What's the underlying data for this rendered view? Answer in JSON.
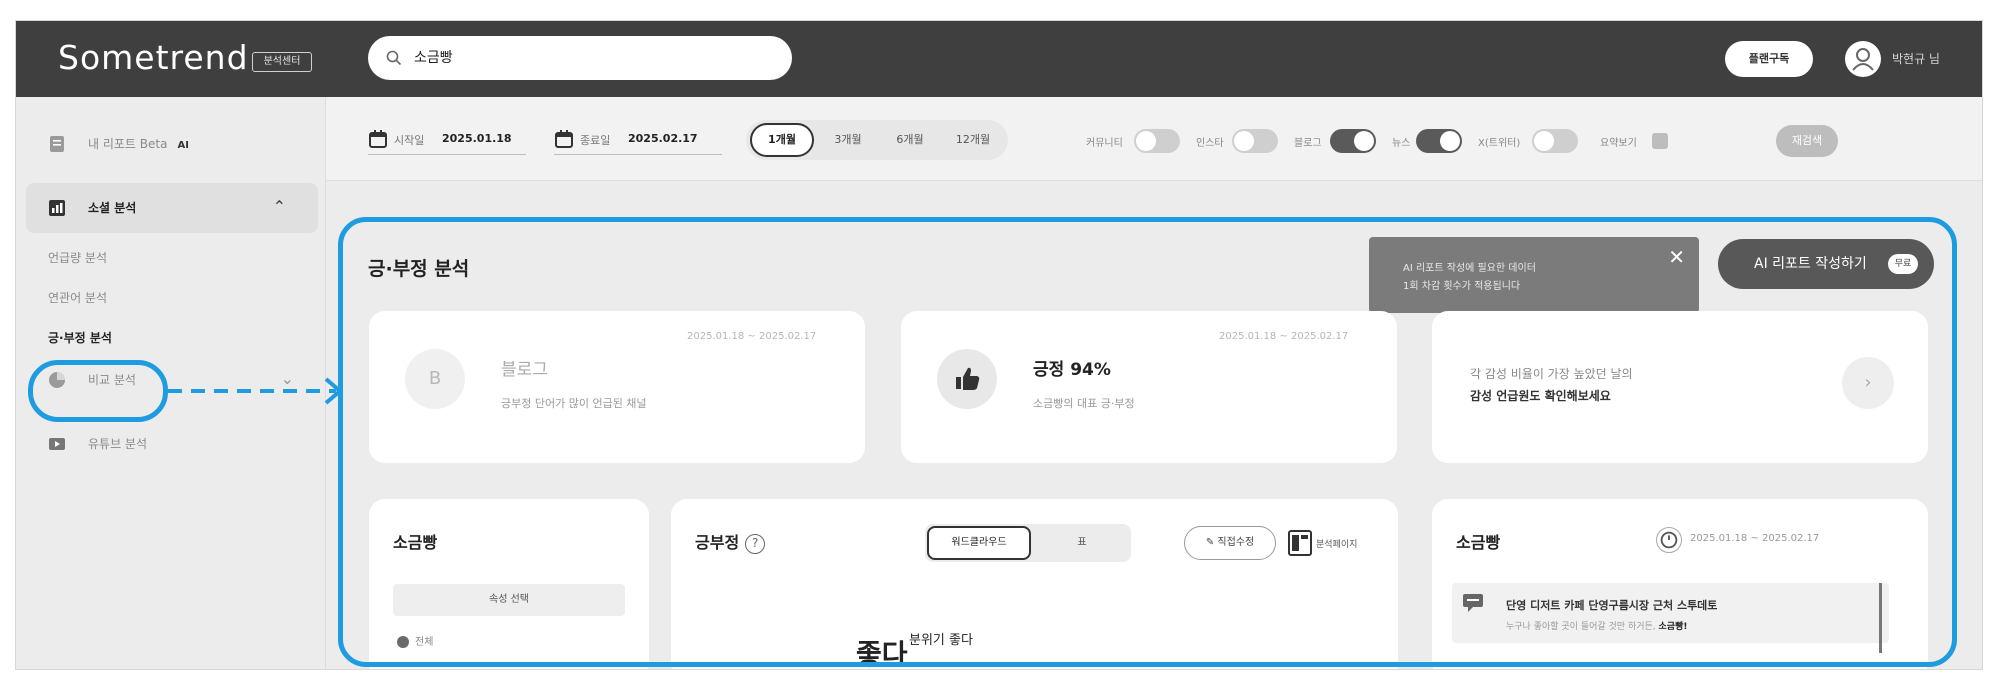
{
  "app": {
    "brand": "Sometrend",
    "brand_badge": "분석센터",
    "upgrade_label": "플랜구독",
    "user_name": "박현규 님"
  },
  "search": {
    "value": "소금빵"
  },
  "sidebar": {
    "items": [
      {
        "label": "내 리포트 Beta",
        "tag": "AI"
      },
      {
        "label": "소셜 분석"
      },
      {
        "label": "비교 분석"
      },
      {
        "label": "유튜브 분석"
      }
    ],
    "sub_items": [
      "언급량 분석",
      "연관어 분석",
      "긍·부정 분석"
    ]
  },
  "filters": {
    "start_label": "시작일",
    "start_date": "2025.01.18",
    "end_label": "종료일",
    "end_date": "2025.02.17",
    "periods": [
      "1개월",
      "3개월",
      "6개월",
      "12개월"
    ],
    "selected_period": "1개월",
    "channels": [
      {
        "label": "커뮤니티",
        "on": false
      },
      {
        "label": "인스타",
        "on": false
      },
      {
        "label": "블로그",
        "on": true
      },
      {
        "label": "뉴스",
        "on": true
      },
      {
        "label": "X(트위터)",
        "on": false
      }
    ],
    "extra_option": "요약보기",
    "apply_label": "재검색"
  },
  "main": {
    "title": "긍·부정 분석",
    "tooltip_line1": "AI 리포트 작성에 필요한 데이터",
    "tooltip_line2": "1회 차감 횟수가 적용됩니다",
    "ai_report_label": "AI 리포트 작성하기",
    "ai_report_badge": "무료",
    "cards": [
      {
        "avatar": "B",
        "title": "블로그",
        "subtitle": "긍부정 단어가 많이 언급된 채널",
        "period": "2025.01.18 ~ 2025.02.17"
      },
      {
        "title": "긍정 94%",
        "subtitle": "소금빵의 대표 긍·부정",
        "period": "2025.01.18 ~ 2025.02.17"
      },
      {
        "line1": "각 감성 비율이 가장 높았던 날의",
        "line2": "감성 언급원도 확인해보세요"
      }
    ],
    "left_panel": {
      "title": "소금빵",
      "attr_button": "속성 선택",
      "option": "전체"
    },
    "center_panel": {
      "title": "긍부정",
      "help": "?",
      "tab_active": "워드클라우드",
      "tab_other": "표",
      "edit_label": "직접수정",
      "tool_label": "분석페이지",
      "word_big": "좋다",
      "word_small": "분위기 좋다"
    },
    "right_panel": {
      "title": "소금빵",
      "period": "2025.01.18 ~ 2025.02.17",
      "news_title": "단영 디저트 카페 단영구름시장 근처 스투데토",
      "news_sub_prefix": "누구나 좋아할 곳이 들어갈 것만 하거든, ",
      "news_sub_bold": "소금빵!"
    }
  },
  "colors": {
    "highlight": "#1f9be0",
    "topbar": "#3f3f3f"
  },
  "icons": [
    "search-icon",
    "calendar-icon",
    "thumbs-up-icon",
    "chevron-right-icon",
    "clock-icon",
    "chat-icon",
    "close-icon",
    "pencil-icon"
  ]
}
